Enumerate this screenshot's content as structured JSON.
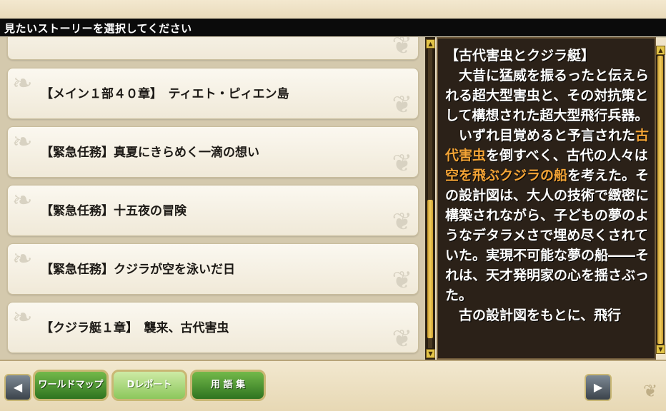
{
  "header": {
    "title": "見たいストーリーを選択してください"
  },
  "story_list": {
    "items": [
      {
        "label": ""
      },
      {
        "label": "【メイン１部４０章】　ティエト・ピィエン島"
      },
      {
        "label": "【緊急任務】真夏にきらめく一滴の想い"
      },
      {
        "label": "【緊急任務】十五夜の冒険"
      },
      {
        "label": "【緊急任務】クジラが空を泳いだ日"
      },
      {
        "label": "【クジラ艇１章】　襲来、古代害虫"
      }
    ],
    "scroll_up": "▲",
    "scroll_down": "▼"
  },
  "detail": {
    "title": "【古代害虫とクジラ艇】",
    "p1": "　大昔に猛威を振るったと伝えられる超大型害虫と、その対抗策として構想された超大型飛行兵器。",
    "p2_pre": "　いずれ目覚めると予言された",
    "p2_hl1": "古代害虫",
    "p2_mid": "を倒すべく、古代の人々は",
    "p2_hl2": "空を飛ぶクジラの船",
    "p2_post": "を考えた。その設計図は、大人の技術で緻密に構築されながら、子どもの夢のようなデタラメさで埋め尽くされていた。実現不可能な夢の船――それは、天才発明家の心を揺さぶった。",
    "p3": "　古の設計図をもとに、飛行",
    "highlight_color": "#f4a436",
    "scroll_up": "▲",
    "scroll_down": "▼"
  },
  "footer": {
    "prev_icon": "◀",
    "next_icon": "▶",
    "world_map": "ワールドマップ",
    "d_report": "Dレポート",
    "glossary": "用 語 集"
  }
}
